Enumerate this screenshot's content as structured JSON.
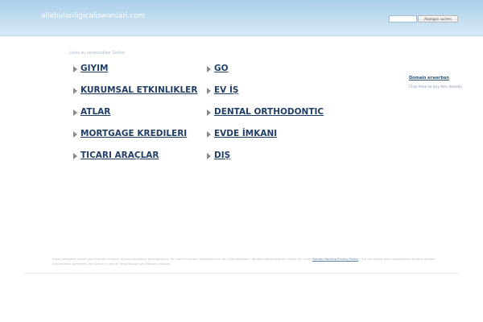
{
  "header": {
    "domain": "allebulanligicaliswanlari.com",
    "search_placeholder": "",
    "search_button": "Anzeigen suchen"
  },
  "links": {
    "heading": "Links zu verwandten Seiten",
    "left": [
      {
        "label": "GIYIM"
      },
      {
        "label": "KURUMSAL ETKINLIKLER"
      },
      {
        "label": "ATLAR"
      },
      {
        "label": "MORTGAGE KREDILERI"
      },
      {
        "label": "TICARI ARAÇLAR"
      }
    ],
    "right": [
      {
        "label": "GO"
      },
      {
        "label": "EV İŞ"
      },
      {
        "label": "DENTAL ORTHODONTIC"
      },
      {
        "label": "EVDE İMKANI"
      },
      {
        "label": "DIŞ"
      }
    ]
  },
  "sidebar": {
    "title": "Domain erwerben",
    "text": "Click here to buy this domain"
  },
  "footer": {
    "text_before": "Diese Webseite wurde vom Domain-Inhaber (Domainbesitzer) bereitgestellt. Sie steht in keiner Verbindung zu den Dienstleistern. Weitere Informationen finden Sie unter",
    "privacy_link": "Domain Parking Privacy Policy",
    "text_after": ". Die auf dieser Seite angezeigten Inhalte wurden automatisch generiert und stehen in keiner Verbindung zum Domain-Inhaber."
  },
  "colors": {
    "header_gradient_top": "#aacfe9",
    "header_gradient_bottom": "#d8e9f5",
    "link": "#213e66",
    "arrow": "#8a8a8a"
  }
}
